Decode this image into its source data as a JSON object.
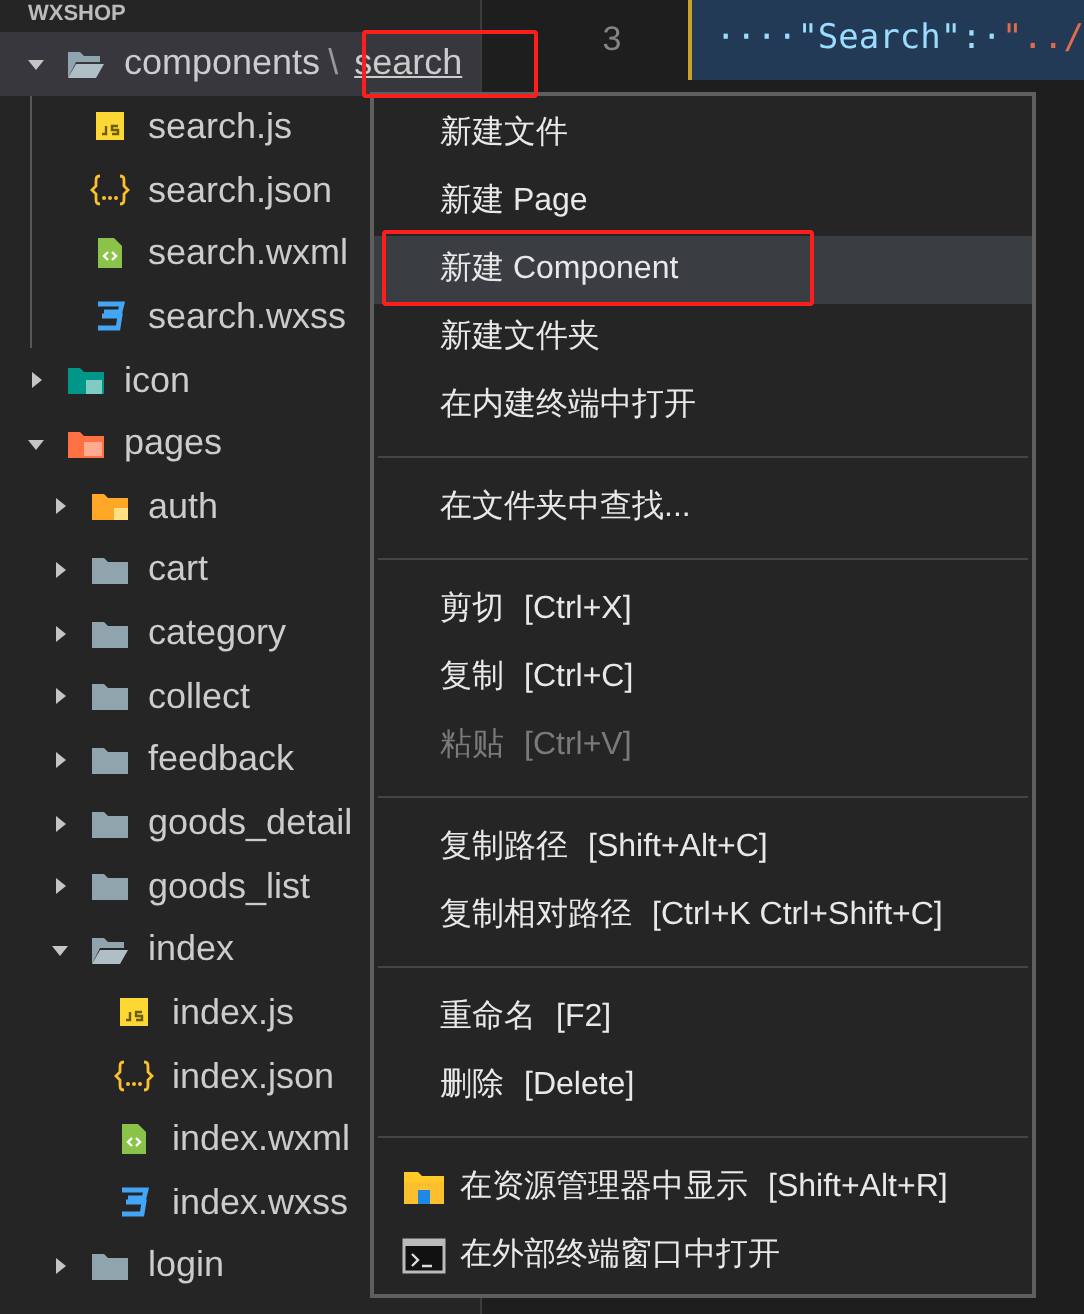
{
  "explorer": {
    "title": "WXSHOP",
    "tree": [
      {
        "label": "components",
        "compact_separator": "\\",
        "compact_child": "search",
        "kind": "folder",
        "expanded": true,
        "selected": true,
        "children": [
          {
            "label": "search.js",
            "kind": "js",
            "selected": false
          },
          {
            "label": "search.json",
            "kind": "json",
            "selected": false
          },
          {
            "label": "search.wxml",
            "kind": "wxml",
            "selected": false
          },
          {
            "label": "search.wxss",
            "kind": "wxss",
            "selected": false
          }
        ]
      },
      {
        "label": "icon",
        "kind": "assets",
        "expanded": false,
        "selected": false
      },
      {
        "label": "pages",
        "kind": "pages",
        "expanded": true,
        "selected": false,
        "children": [
          {
            "label": "auth",
            "kind": "locked",
            "expanded": false,
            "selected": false
          },
          {
            "label": "cart",
            "kind": "folder",
            "expanded": false,
            "selected": false
          },
          {
            "label": "category",
            "kind": "folder",
            "expanded": false,
            "selected": false
          },
          {
            "label": "collect",
            "kind": "folder",
            "expanded": false,
            "selected": false
          },
          {
            "label": "feedback",
            "kind": "folder",
            "expanded": false,
            "selected": false
          },
          {
            "label": "goods_detail",
            "kind": "folder",
            "expanded": false,
            "selected": false
          },
          {
            "label": "goods_list",
            "kind": "folder",
            "expanded": false,
            "selected": false
          },
          {
            "label": "index",
            "kind": "folder",
            "expanded": true,
            "selected": false,
            "children": [
              {
                "label": "index.js",
                "kind": "js",
                "selected": false
              },
              {
                "label": "index.json",
                "kind": "json",
                "selected": false
              },
              {
                "label": "index.wxml",
                "kind": "wxml",
                "selected": false
              },
              {
                "label": "index.wxss",
                "kind": "wxss",
                "selected": false
              }
            ]
          },
          {
            "label": "login",
            "kind": "folder",
            "expanded": false,
            "selected": false
          }
        ]
      }
    ]
  },
  "editor": {
    "line_number": "3",
    "code_key": "····\"Search\":·",
    "code_value": "\"../"
  },
  "context_menu": {
    "groups": [
      [
        {
          "label": "新建文件",
          "kind": "plain",
          "selected": false,
          "disabled": false
        },
        {
          "label": "新建 Page",
          "kind": "plain",
          "selected": false,
          "disabled": false
        },
        {
          "label": "新建 Component",
          "kind": "plain",
          "selected": true,
          "disabled": false
        },
        {
          "label": "新建文件夹",
          "kind": "plain",
          "selected": false,
          "disabled": false
        },
        {
          "label": "在内建终端中打开",
          "kind": "plain",
          "selected": false,
          "disabled": false
        }
      ],
      [
        {
          "label": "在文件夹中查找...",
          "kind": "plain",
          "selected": false,
          "disabled": false
        }
      ],
      [
        {
          "label": "剪切",
          "shortcut": "[Ctrl+X]",
          "kind": "plain",
          "selected": false,
          "disabled": false
        },
        {
          "label": "复制",
          "shortcut": "[Ctrl+C]",
          "kind": "plain",
          "selected": false,
          "disabled": false
        },
        {
          "label": "粘贴",
          "shortcut": "[Ctrl+V]",
          "kind": "plain",
          "selected": false,
          "disabled": true
        }
      ],
      [
        {
          "label": "复制路径",
          "shortcut": "[Shift+Alt+C]",
          "kind": "plain",
          "selected": false,
          "disabled": false
        },
        {
          "label": "复制相对路径",
          "shortcut": "[Ctrl+K Ctrl+Shift+C]",
          "kind": "plain",
          "selected": false,
          "disabled": false
        }
      ],
      [
        {
          "label": "重命名",
          "shortcut": "[F2]",
          "kind": "plain",
          "selected": false,
          "disabled": false
        },
        {
          "label": "删除",
          "shortcut": "[Delete]",
          "kind": "plain",
          "selected": false,
          "disabled": false
        }
      ],
      [
        {
          "label": "在资源管理器中显示",
          "shortcut": "[Shift+Alt+R]",
          "kind": "explorer",
          "selected": false,
          "disabled": false
        },
        {
          "label": "在外部终端窗口中打开",
          "kind": "terminal",
          "selected": false,
          "disabled": false
        }
      ]
    ]
  }
}
